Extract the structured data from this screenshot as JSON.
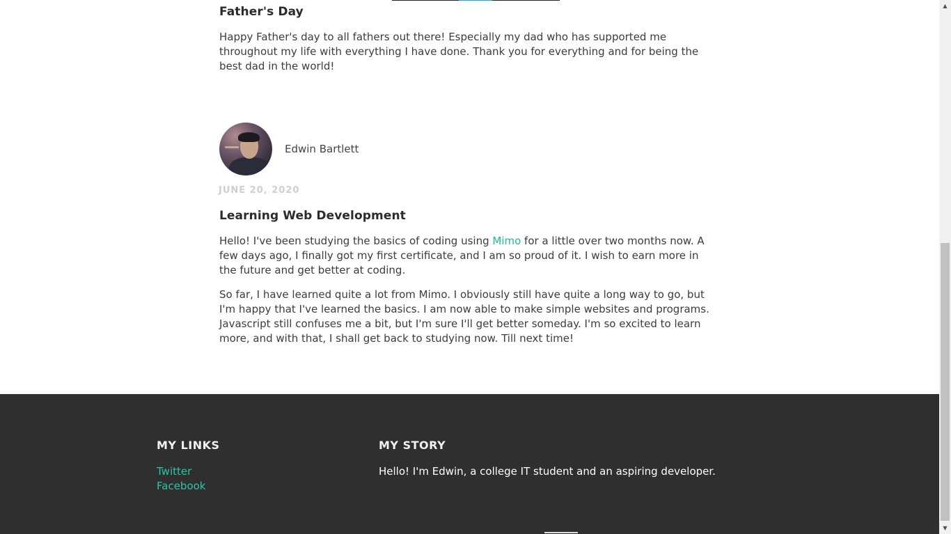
{
  "posts": [
    {
      "title": "Father's Day",
      "paragraphs": [
        "Happy Father's day to all fathers out there! Especially my dad who has supported me throughout my life with everything I have done. Thank you for everything and for being the best dad in the world!"
      ]
    },
    {
      "author": "Edwin Bartlett",
      "date": "JUNE 20, 2020",
      "title": "Learning Web Development",
      "p1_before": "Hello! I've been studying the basics of coding using ",
      "p1_link": "Mimo",
      "p1_after": " for a little over two months now. A few days ago, I finally got my first certificate, and I am so proud of it. I wish to earn more in the future and get better at coding.",
      "p2": "So far, I have learned quite a lot from Mimo. I obviously still have quite a long way to go, but I'm happy that I've learned the basics. I am now able to make simple websites and programs. Javascript still confuses me a bit, but I'm sure I'll get better someday. I'm so excited to learn more, and with that, I shall get back to studying now. Till next time!"
    }
  ],
  "footer": {
    "links_heading": "MY LINKS",
    "links": [
      "Twitter",
      "Facebook"
    ],
    "story_heading": "MY STORY",
    "story_text": "Hello! I'm Edwin, a college IT student and an aspiring developer."
  },
  "colors": {
    "accent": "#26b39a",
    "footer_bg": "#2f2f2f",
    "date": "#cfcfcf"
  },
  "icons": {
    "scroll_up": "triangle-up-icon",
    "scroll_down": "triangle-down-icon"
  }
}
